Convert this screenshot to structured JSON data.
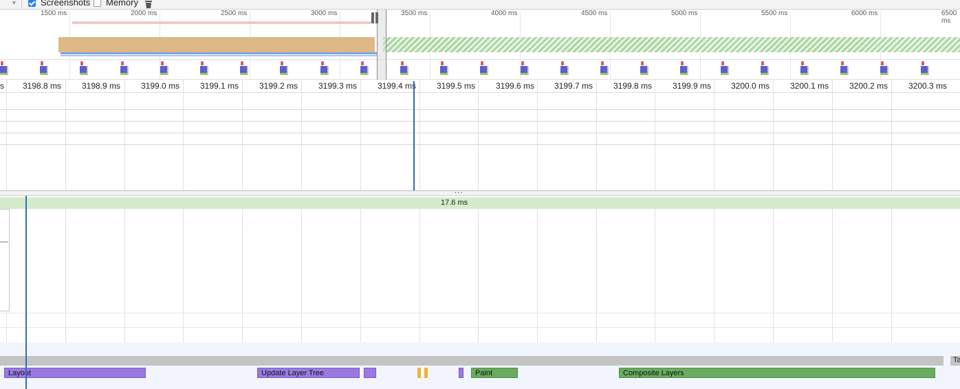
{
  "toolbar": {
    "screenshots_label": "Screenshots",
    "screenshots_checked": true,
    "memory_label": "Memory",
    "memory_checked": false,
    "trash_icon": "trash-icon"
  },
  "overview": {
    "ticks": [
      "1500 ms",
      "2000 ms",
      "2500 ms",
      "3000 ms",
      "3500 ms",
      "4000 ms",
      "4500 ms",
      "5000 ms",
      "5500 ms",
      "6000 ms",
      "6500 ms"
    ]
  },
  "ruler": {
    "ticks": [
      "s",
      "3198.8 ms",
      "3198.9 ms",
      "3199.0 ms",
      "3199.1 ms",
      "3199.2 ms",
      "3199.3 ms",
      "3199.4 ms",
      "3199.5 ms",
      "3199.6 ms",
      "3199.7 ms",
      "3199.8 ms",
      "3199.9 ms",
      "3200.0 ms",
      "3200.1 ms",
      "3200.2 ms",
      "3200.3 ms"
    ]
  },
  "splitter": {
    "label": "..."
  },
  "frame": {
    "duration": "17.6 ms"
  },
  "main_thread": {
    "task_cut_label": "Ta",
    "events": [
      {
        "label": "Layout",
        "kind": "rendering"
      },
      {
        "label": "Update Layer Tree",
        "kind": "rendering"
      },
      {
        "label": "",
        "kind": "rendering"
      },
      {
        "label": "",
        "kind": "scripting"
      },
      {
        "label": "",
        "kind": "scripting"
      },
      {
        "label": "",
        "kind": "rendering"
      },
      {
        "label": "Paint",
        "kind": "painting"
      },
      {
        "label": "Composite Layers",
        "kind": "painting"
      }
    ]
  },
  "colors": {
    "rendering": "#9a7ae0",
    "painting": "#6aab60",
    "scripting": "#f0b33a",
    "loading_band": "#deb887",
    "frame_bar": "#d4eccc",
    "cursor": "#2d6bc1"
  }
}
